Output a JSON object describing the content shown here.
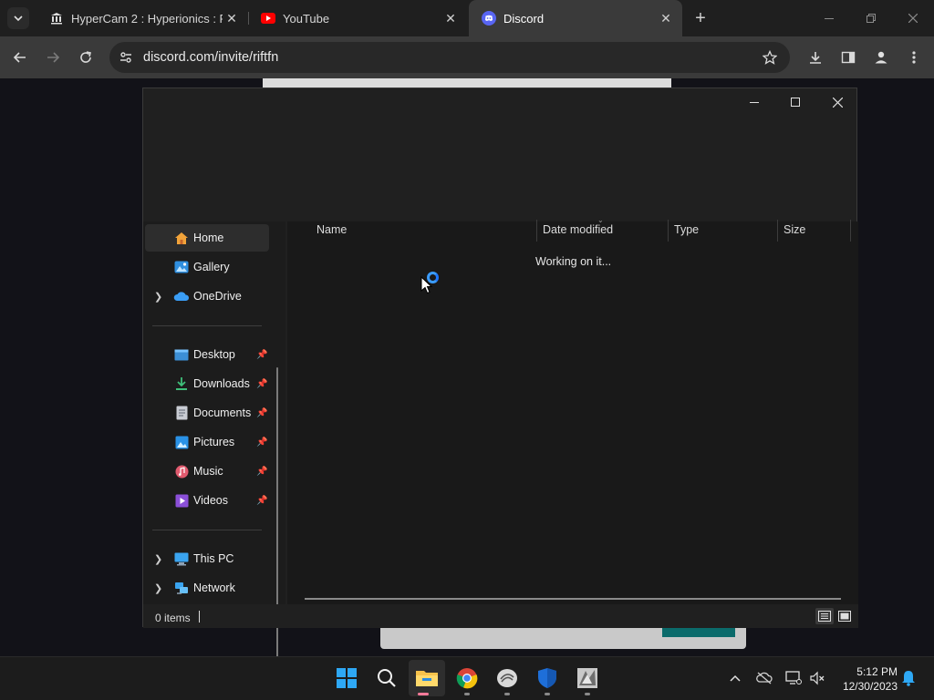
{
  "browser": {
    "tabs": [
      {
        "title": "HyperCam 2 : Hyperionics : Free",
        "icon": "museum-icon"
      },
      {
        "title": "YouTube",
        "icon": "youtube-icon"
      },
      {
        "title": "Discord",
        "icon": "discord-icon",
        "active": true
      }
    ],
    "url": "discord.com/invite/riftfn",
    "colors": {
      "tabbar": "#1f1f1f",
      "toolbar": "#3a3a3a"
    }
  },
  "explorer": {
    "nav": [
      {
        "label": "Home",
        "icon": "home-icon",
        "selected": true
      },
      {
        "label": "Gallery",
        "icon": "gallery-icon"
      },
      {
        "label": "OneDrive",
        "icon": "cloud-icon",
        "expandable": true
      },
      {
        "label": "Desktop",
        "icon": "desktop-icon",
        "pinned": true
      },
      {
        "label": "Downloads",
        "icon": "download-icon",
        "pinned": true
      },
      {
        "label": "Documents",
        "icon": "document-icon",
        "pinned": true
      },
      {
        "label": "Pictures",
        "icon": "pictures-icon",
        "pinned": true
      },
      {
        "label": "Music",
        "icon": "music-icon",
        "pinned": true
      },
      {
        "label": "Videos",
        "icon": "videos-icon",
        "pinned": true
      },
      {
        "label": "This PC",
        "icon": "computer-icon",
        "expandable": true
      },
      {
        "label": "Network",
        "icon": "network-icon",
        "expandable": true
      }
    ],
    "columns": [
      "Name",
      "Date modified",
      "Type",
      "Size"
    ],
    "status_message": "Working on it...",
    "item_count": "0 items"
  },
  "taskbar": {
    "apps": [
      "windows-start-icon",
      "search-icon",
      "file-explorer-icon",
      "chrome-icon",
      "app-icon",
      "defender-icon",
      "game-icon"
    ],
    "time": "5:12 PM",
    "date": "12/30/2023"
  }
}
